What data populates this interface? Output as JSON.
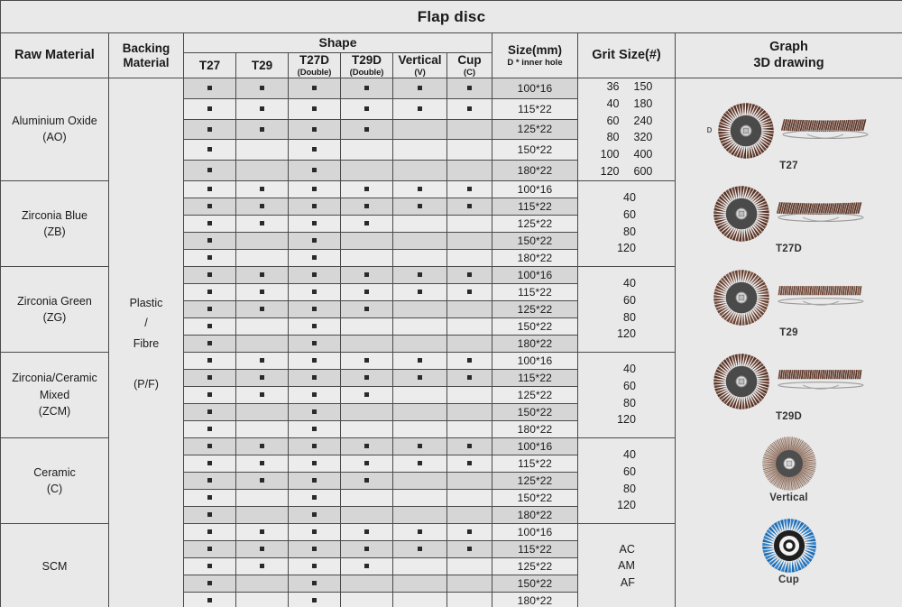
{
  "title": "Flap disc",
  "accent_color": "#a52028",
  "header": {
    "raw_material": "Raw Material",
    "backing_material_l1": "Backing",
    "backing_material_l2": "Material",
    "shape": "Shape",
    "shapes": [
      {
        "name": "T27",
        "sub": ""
      },
      {
        "name": "T29",
        "sub": ""
      },
      {
        "name": "T27D",
        "sub": "(Double)"
      },
      {
        "name": "T29D",
        "sub": "(Double)"
      },
      {
        "name": "Vertical",
        "sub": "(V)"
      },
      {
        "name": "Cup",
        "sub": "(C)"
      }
    ],
    "size": "Size(mm)",
    "size_sub": "D * inner hole",
    "grit_size": "Grit Size(#)",
    "graph_l1": "Graph",
    "graph_l2": "3D drawing"
  },
  "backing_material": {
    "line1": "Plastic",
    "line2": "/",
    "line3": "Fibre",
    "line4": "(P/F)"
  },
  "sizes": [
    "100*16",
    "115*22",
    "125*22",
    "150*22",
    "180*22"
  ],
  "dot_matrix": [
    [
      true,
      true,
      true,
      true,
      true,
      true
    ],
    [
      true,
      true,
      true,
      true,
      true,
      true
    ],
    [
      true,
      true,
      true,
      true,
      false,
      false
    ],
    [
      true,
      false,
      true,
      false,
      false,
      false
    ],
    [
      true,
      false,
      true,
      false,
      false,
      false
    ]
  ],
  "groups": [
    {
      "material_l1": "Aluminium Oxide",
      "material_l2": "(AO)",
      "grit_col1": [
        "36",
        "40",
        "60",
        "80",
        "100",
        "120"
      ],
      "grit_col2": [
        "150",
        "180",
        "240",
        "320",
        "400",
        "600"
      ]
    },
    {
      "material_l1": "Zirconia Blue",
      "material_l2": "(ZB)",
      "grit_col1": [
        "40",
        "60",
        "80",
        "120"
      ],
      "grit_col2": []
    },
    {
      "material_l1": "Zirconia Green",
      "material_l2": "(ZG)",
      "grit_col1": [
        "40",
        "60",
        "80",
        "120"
      ],
      "grit_col2": []
    },
    {
      "material_l1": "Zirconia/Ceramic",
      "material_l2": "Mixed",
      "material_l3": "(ZCM)",
      "grit_col1": [
        "40",
        "60",
        "80",
        "120"
      ],
      "grit_col2": []
    },
    {
      "material_l1": "Ceramic",
      "material_l2": "(C)",
      "grit_col1": [
        "40",
        "60",
        "80",
        "120"
      ],
      "grit_col2": []
    },
    {
      "material_l1": "SCM",
      "material_l2": "",
      "grit_col1": [
        "AC",
        "AM",
        "AF"
      ],
      "grit_col2": []
    }
  ],
  "graphs": [
    {
      "label": "T27",
      "dim": "D",
      "color": "#6b4436",
      "style": "disc-side"
    },
    {
      "label": "T27D",
      "dim": "",
      "color": "#6b4436",
      "style": "disc-side"
    },
    {
      "label": "T29",
      "dim": "",
      "color": "#7a5242",
      "style": "disc-side-flat"
    },
    {
      "label": "T29D",
      "dim": "",
      "color": "#6b4436",
      "style": "disc-side-flat"
    },
    {
      "label": "Vertical",
      "dim": "",
      "color": "#9b7b6a",
      "style": "disc-only"
    },
    {
      "label": "Cup",
      "dim": "",
      "color": "#2b7cc4",
      "style": "disc-only-blue"
    }
  ]
}
